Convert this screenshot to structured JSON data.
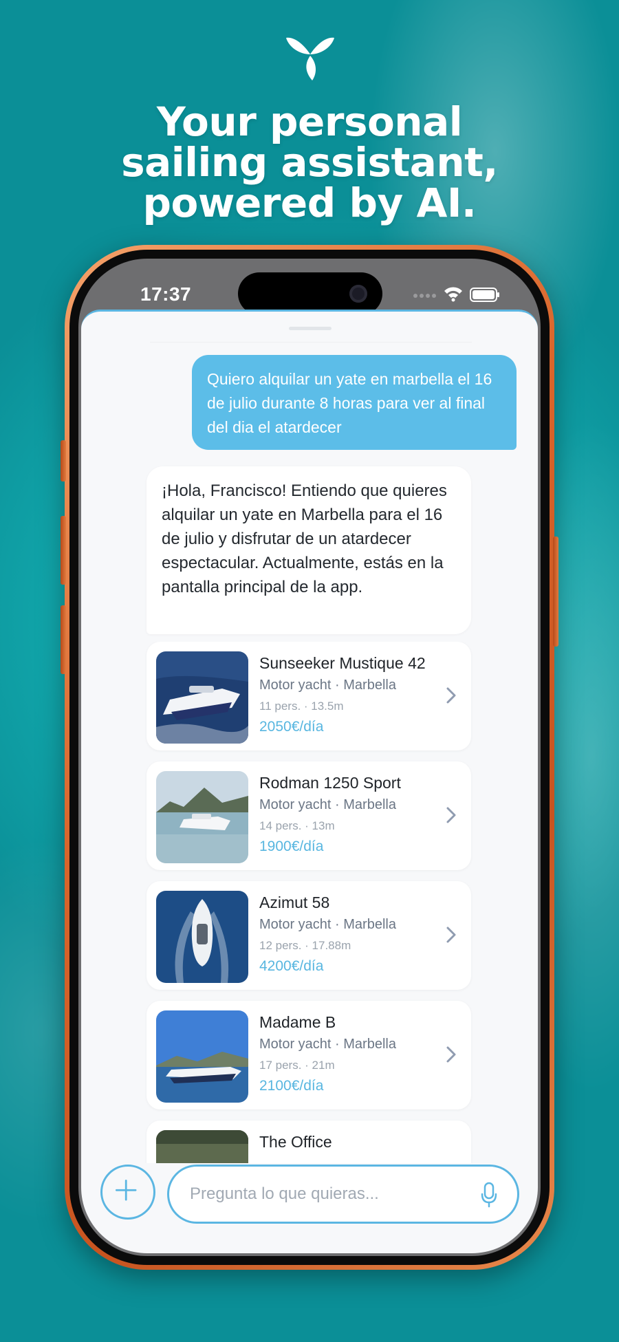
{
  "headline": [
    "Your personal",
    "sailing assistant,",
    "powered by AI."
  ],
  "status_bar": {
    "time": "17:37"
  },
  "chat": {
    "user_message": "Quiero alquilar un yate en marbella el 16 de julio durante 8 horas para ver al final del dia el atardecer",
    "assistant_message": "¡Hola, Francisco! Entiendo que quieres alquilar un yate en Marbella para el 16 de julio y disfrutar de un atardecer espectacular. Actualmente, estás en la pantalla principal de la app."
  },
  "boats": [
    {
      "name": "Sunseeker Mustique 42",
      "type": "Motor yacht · Marbella",
      "specs": "11 pers. · 13.5m",
      "price": "2050€/día"
    },
    {
      "name": "Rodman 1250 Sport",
      "type": "Motor yacht · Marbella",
      "specs": "14 pers. · 13m",
      "price": "1900€/día"
    },
    {
      "name": "Azimut 58",
      "type": "Motor yacht · Marbella",
      "specs": "12 pers. · 17.88m",
      "price": "4200€/día"
    },
    {
      "name": "Madame B",
      "type": "Motor yacht · Marbella",
      "specs": "17 pers. · 21m",
      "price": "2100€/día"
    },
    {
      "name": "The Office",
      "type": "",
      "specs": "",
      "price": ""
    }
  ],
  "composer": {
    "placeholder": "Pregunta lo que quieras..."
  },
  "colors": {
    "accent": "#5bb6e2",
    "user_bubble": "#5cbde8",
    "price": "#58b6e0",
    "phone_frame": "#d9652b",
    "sea": "#12a9ad"
  },
  "icons": [
    "brand-logo-icon",
    "wifi-icon",
    "battery-icon",
    "chevron-right-icon",
    "plus-icon",
    "microphone-icon"
  ]
}
